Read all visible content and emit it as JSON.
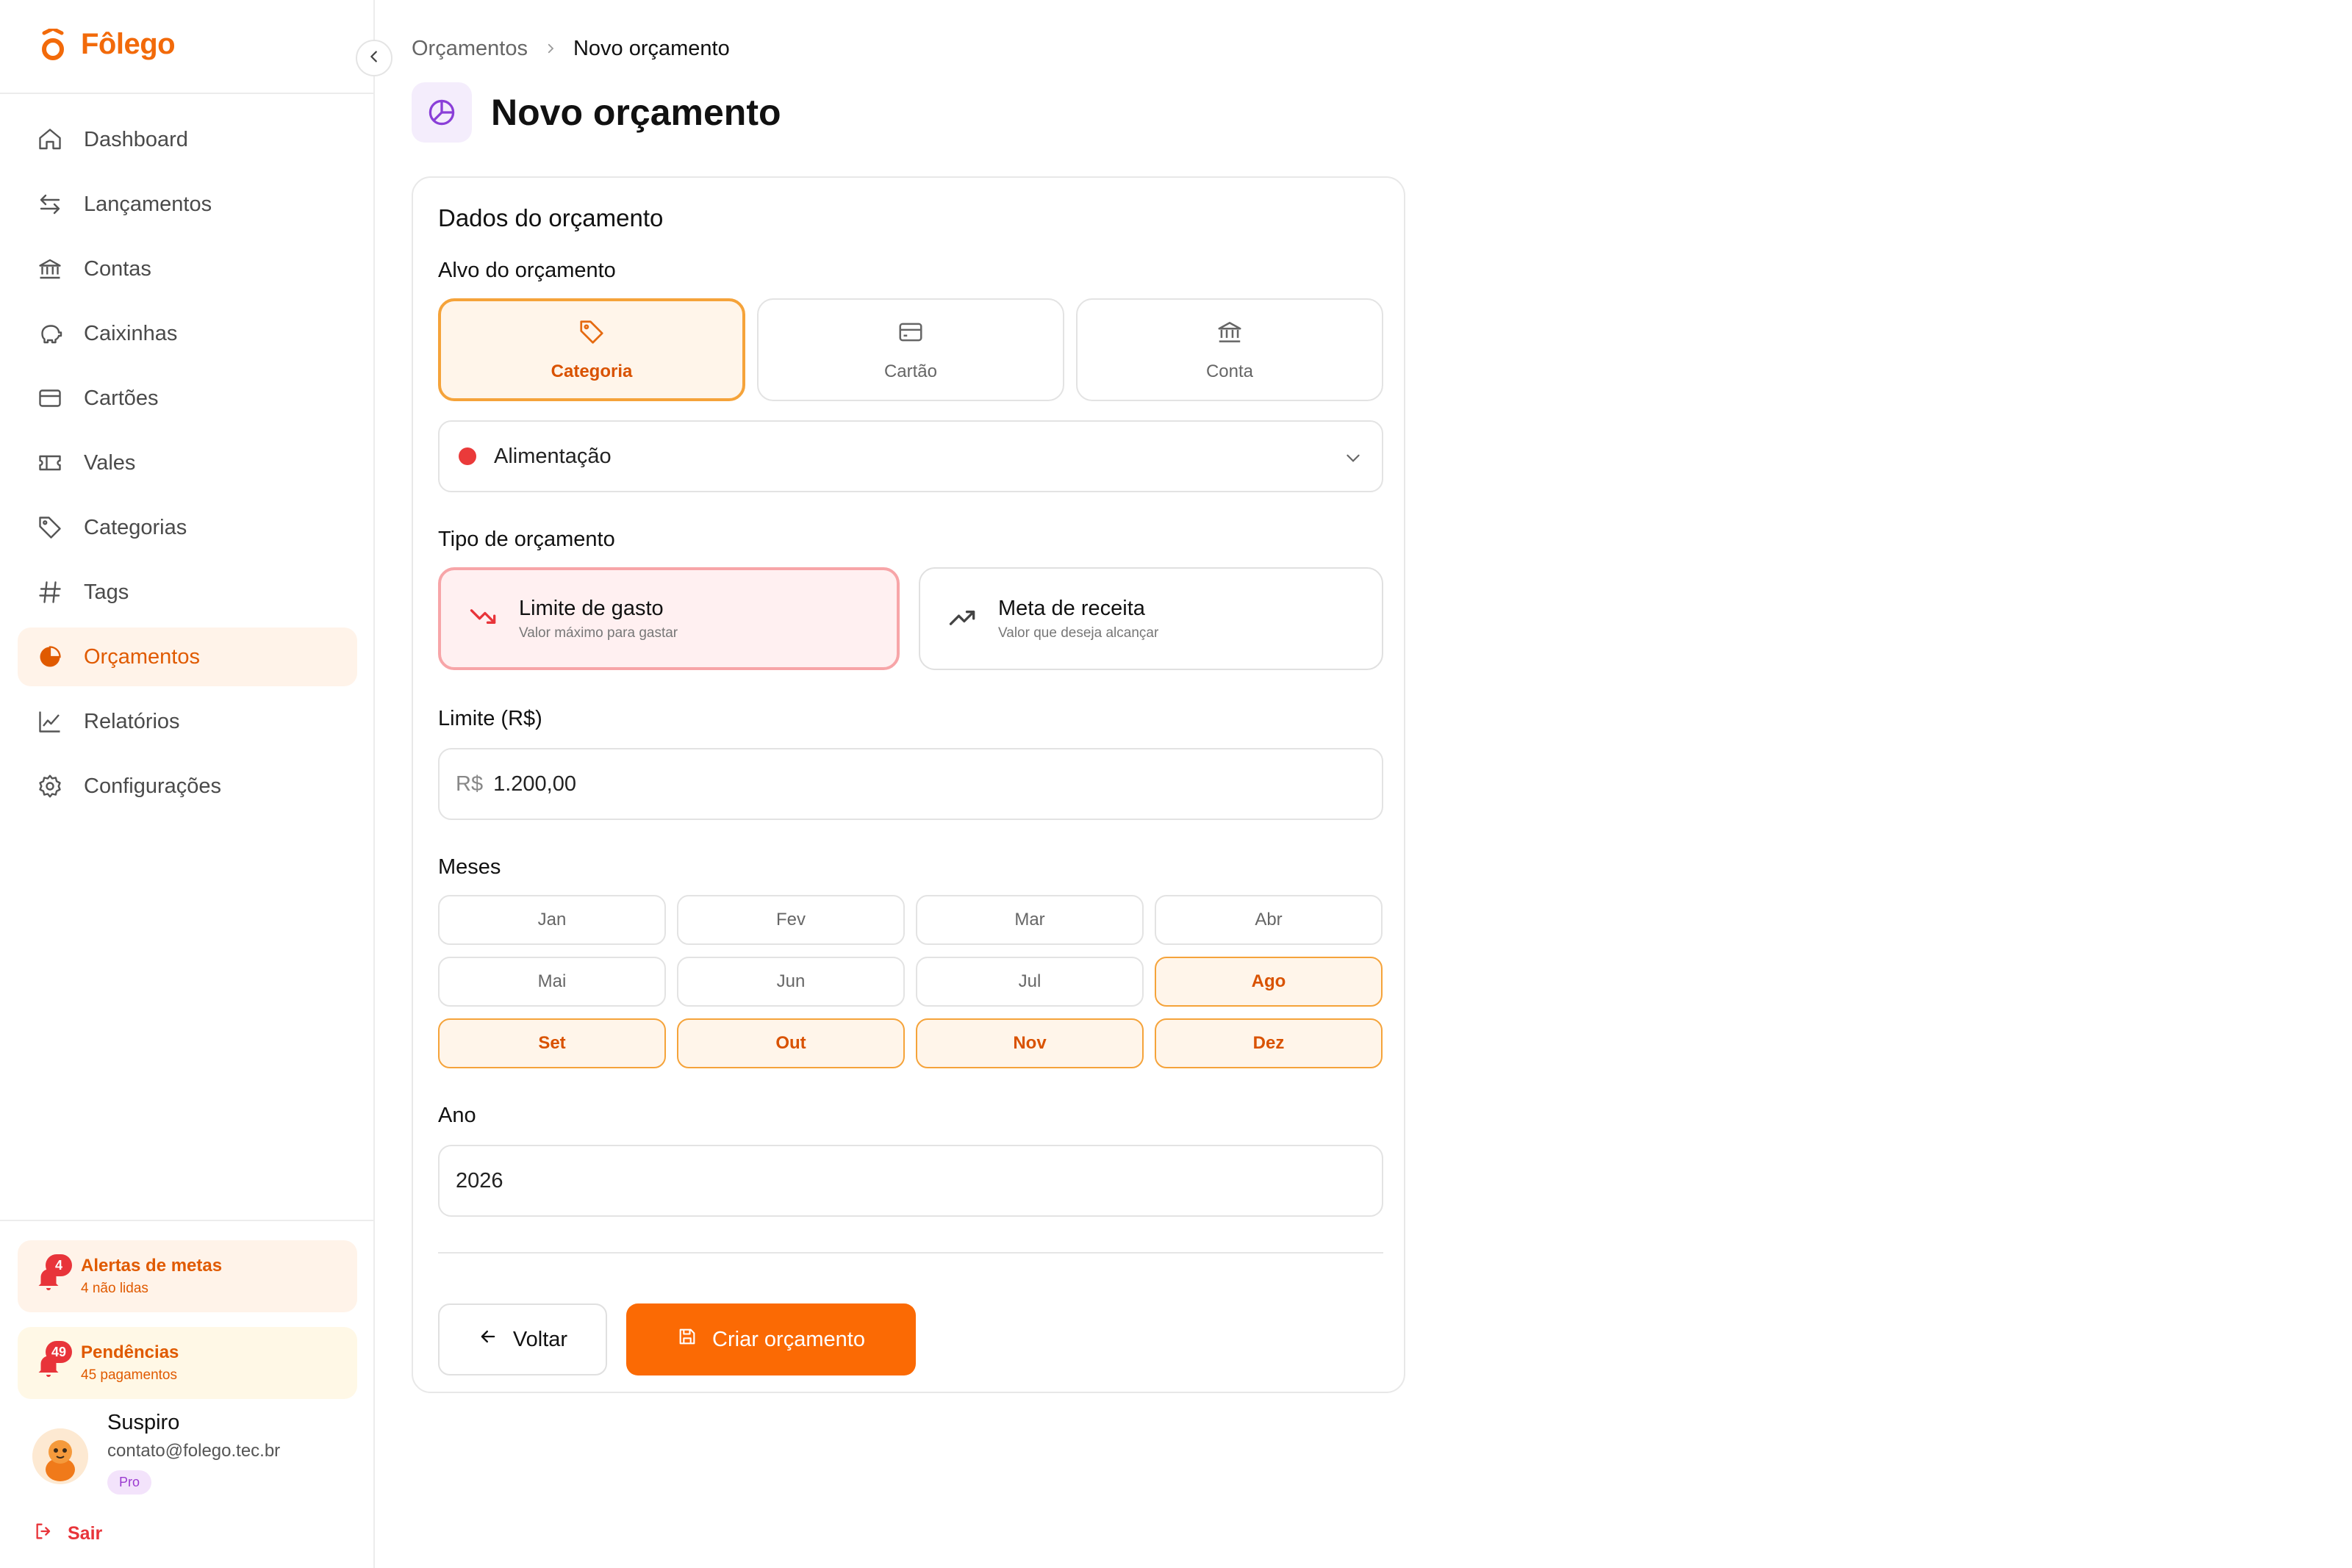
{
  "brand": {
    "name": "Fôlego",
    "accent": "#f26a0a"
  },
  "sidebar": {
    "collapse_icon": "chevron-left-icon",
    "items": [
      {
        "label": "Dashboard",
        "icon": "home-icon"
      },
      {
        "label": "Lançamentos",
        "icon": "arrows-left-right-icon"
      },
      {
        "label": "Contas",
        "icon": "bank-icon"
      },
      {
        "label": "Caixinhas",
        "icon": "piggy-bank-icon"
      },
      {
        "label": "Cartões",
        "icon": "credit-card-icon"
      },
      {
        "label": "Vales",
        "icon": "ticket-icon"
      },
      {
        "label": "Categorias",
        "icon": "tag-icon"
      },
      {
        "label": "Tags",
        "icon": "hash-icon"
      },
      {
        "label": "Orçamentos",
        "icon": "pie-chart-icon",
        "active": true
      },
      {
        "label": "Relatórios",
        "icon": "line-chart-icon"
      },
      {
        "label": "Configurações",
        "icon": "gear-icon"
      }
    ],
    "alerts": [
      {
        "title": "Alertas de metas",
        "subtitle": "4 não lidas",
        "count": "4"
      },
      {
        "title": "Pendências",
        "subtitle": "45 pagamentos",
        "count": "49"
      }
    ],
    "user": {
      "name": "Suspiro",
      "email": "contato@folego.tec.br",
      "plan": "Pro"
    },
    "logout_label": "Sair"
  },
  "breadcrumb": {
    "parent": "Orçamentos",
    "current": "Novo orçamento"
  },
  "page_title": "Novo orçamento",
  "form": {
    "section_title": "Dados do orçamento",
    "target": {
      "label": "Alvo do orçamento",
      "options": [
        {
          "label": "Categoria",
          "icon": "tag-icon",
          "selected": true
        },
        {
          "label": "Cartão",
          "icon": "credit-card-icon",
          "selected": false
        },
        {
          "label": "Conta",
          "icon": "bank-icon",
          "selected": false
        }
      ],
      "selected_value": "Alimentação",
      "selected_color": "#ea3a3a"
    },
    "type": {
      "label": "Tipo de orçamento",
      "options": [
        {
          "title": "Limite de gasto",
          "subtitle": "Valor máximo para gastar",
          "icon": "trending-down-icon",
          "selected": true
        },
        {
          "title": "Meta de receita",
          "subtitle": "Valor que deseja alcançar",
          "icon": "trending-up-icon",
          "selected": false
        }
      ]
    },
    "limit": {
      "label": "Limite (R$)",
      "prefix": "R$",
      "value": "1.200,00"
    },
    "months": {
      "label": "Meses",
      "items": [
        {
          "label": "Jan",
          "selected": false
        },
        {
          "label": "Fev",
          "selected": false
        },
        {
          "label": "Mar",
          "selected": false
        },
        {
          "label": "Abr",
          "selected": false
        },
        {
          "label": "Mai",
          "selected": false
        },
        {
          "label": "Jun",
          "selected": false
        },
        {
          "label": "Jul",
          "selected": false
        },
        {
          "label": "Ago",
          "selected": true
        },
        {
          "label": "Set",
          "selected": true
        },
        {
          "label": "Out",
          "selected": true
        },
        {
          "label": "Nov",
          "selected": true
        },
        {
          "label": "Dez",
          "selected": true
        }
      ]
    },
    "year": {
      "label": "Ano",
      "value": "2026"
    },
    "back_label": "Voltar",
    "submit_label": "Criar orçamento"
  }
}
